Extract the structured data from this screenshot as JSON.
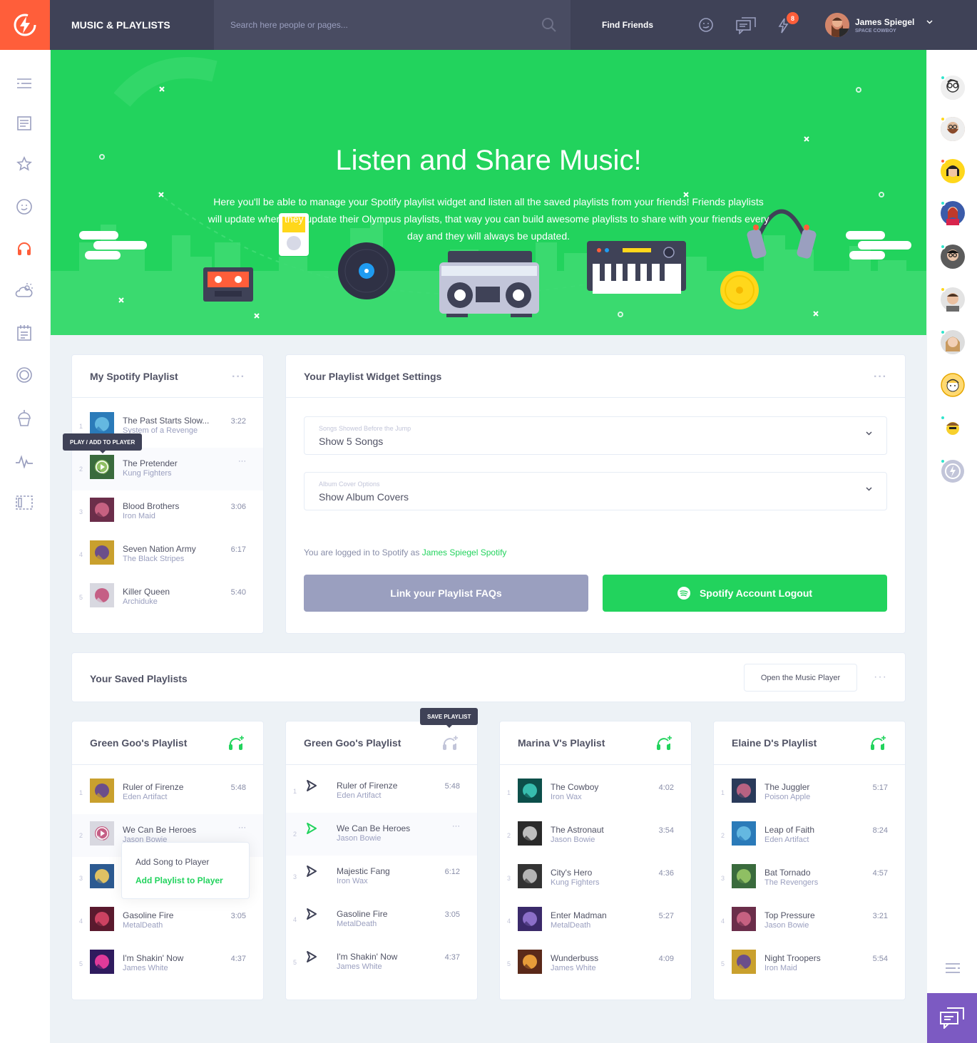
{
  "header": {
    "title": "MUSIC & PLAYLISTS",
    "search_placeholder": "Search here people or pages...",
    "find_friends": "Find Friends",
    "notifications_count": "8",
    "user_name": "James Spiegel",
    "user_status": "SPACE COWBOY"
  },
  "hero": {
    "title": "Listen and Share Music!",
    "text": "Here you'll be able to manage your Spotify playlist widget and listen all the saved playlists from your friends! Friends playlists will update when they update their Olympus playlists, that way you can build awesome playlists to share with your friends every day and they will always be updated."
  },
  "my_playlist": {
    "title": "My Spotify Playlist",
    "tooltip": "PLAY / ADD TO PLAYER",
    "tracks": [
      {
        "num": "1",
        "title": "The Past Starts Slow...",
        "artist": "System of a Revenge",
        "duration": "3:22"
      },
      {
        "num": "2",
        "title": "The Pretender",
        "artist": "Kung Fighters",
        "duration": ""
      },
      {
        "num": "3",
        "title": "Blood Brothers",
        "artist": "Iron Maid",
        "duration": "3:06"
      },
      {
        "num": "4",
        "title": "Seven Nation Army",
        "artist": "The Black Stripes",
        "duration": "6:17"
      },
      {
        "num": "5",
        "title": "Killer Queen",
        "artist": "Archiduke",
        "duration": "5:40"
      }
    ]
  },
  "widget_settings": {
    "title": "Your Playlist Widget Settings",
    "songs_label": "Songs Showed Before the Jump",
    "songs_value": "Show 5 Songs",
    "cover_label": "Album Cover Options",
    "cover_value": "Show Album Covers",
    "logged_text": "You are logged in to Spotify as",
    "logged_user": "James Spiegel Spotify",
    "faq_button": "Link your Playlist FAQs",
    "logout_button": "Spotify Account Logout"
  },
  "saved": {
    "title": "Your Saved Playlists",
    "open_player": "Open the Music Player",
    "save_tooltip": "SAVE PLAYLIST",
    "popup_add_song": "Add Song to Player",
    "popup_add_playlist": "Add Playlist to Player"
  },
  "playlists": [
    {
      "title": "Green Goo's Playlist",
      "tracks": [
        {
          "num": "1",
          "title": "Ruler of Firenze",
          "artist": "Eden Artifact",
          "duration": "5:48"
        },
        {
          "num": "2",
          "title": "We Can Be Heroes",
          "artist": "Jason Bowie",
          "duration": ""
        },
        {
          "num": "3",
          "title": "",
          "artist": "",
          "duration": ""
        },
        {
          "num": "4",
          "title": "Gasoline Fire",
          "artist": "MetalDeath",
          "duration": "3:05"
        },
        {
          "num": "5",
          "title": "I'm Shakin' Now",
          "artist": "James White",
          "duration": "4:37"
        }
      ]
    },
    {
      "title": "Green Goo's Playlist",
      "tracks": [
        {
          "num": "1",
          "title": "Ruler of Firenze",
          "artist": "Eden Artifact",
          "duration": "5:48"
        },
        {
          "num": "2",
          "title": "We Can Be Heroes",
          "artist": "Jason Bowie",
          "duration": ""
        },
        {
          "num": "3",
          "title": "Majestic Fang",
          "artist": "Iron Wax",
          "duration": "6:12"
        },
        {
          "num": "4",
          "title": "Gasoline Fire",
          "artist": "MetalDeath",
          "duration": "3:05"
        },
        {
          "num": "5",
          "title": "I'm Shakin' Now",
          "artist": "James White",
          "duration": "4:37"
        }
      ]
    },
    {
      "title": "Marina V's Playlist",
      "tracks": [
        {
          "num": "1",
          "title": "The Cowboy",
          "artist": "Iron Wax",
          "duration": "4:02"
        },
        {
          "num": "2",
          "title": "The Astronaut",
          "artist": "Jason Bowie",
          "duration": "3:54"
        },
        {
          "num": "3",
          "title": "City's Hero",
          "artist": "Kung Fighters",
          "duration": "4:36"
        },
        {
          "num": "4",
          "title": "Enter Madman",
          "artist": "MetalDeath",
          "duration": "5:27"
        },
        {
          "num": "5",
          "title": "Wunderbuss",
          "artist": "James White",
          "duration": "4:09"
        }
      ]
    },
    {
      "title": "Elaine D's Playlist",
      "tracks": [
        {
          "num": "1",
          "title": "The Juggler",
          "artist": "Poison Apple",
          "duration": "5:17"
        },
        {
          "num": "2",
          "title": "Leap of Faith",
          "artist": "Eden Artifact",
          "duration": "8:24"
        },
        {
          "num": "3",
          "title": "Bat Tornado",
          "artist": "The Revengers",
          "duration": "4:57"
        },
        {
          "num": "4",
          "title": "Top Pressure",
          "artist": "Jason Bowie",
          "duration": "3:21"
        },
        {
          "num": "5",
          "title": "Night Troopers",
          "artist": "Iron Maid",
          "duration": "5:54"
        }
      ]
    }
  ],
  "colors": {
    "accent": "#ff5e3a",
    "green": "#22d35d",
    "dark": "#3f4257",
    "purple": "#7c5ac2"
  }
}
